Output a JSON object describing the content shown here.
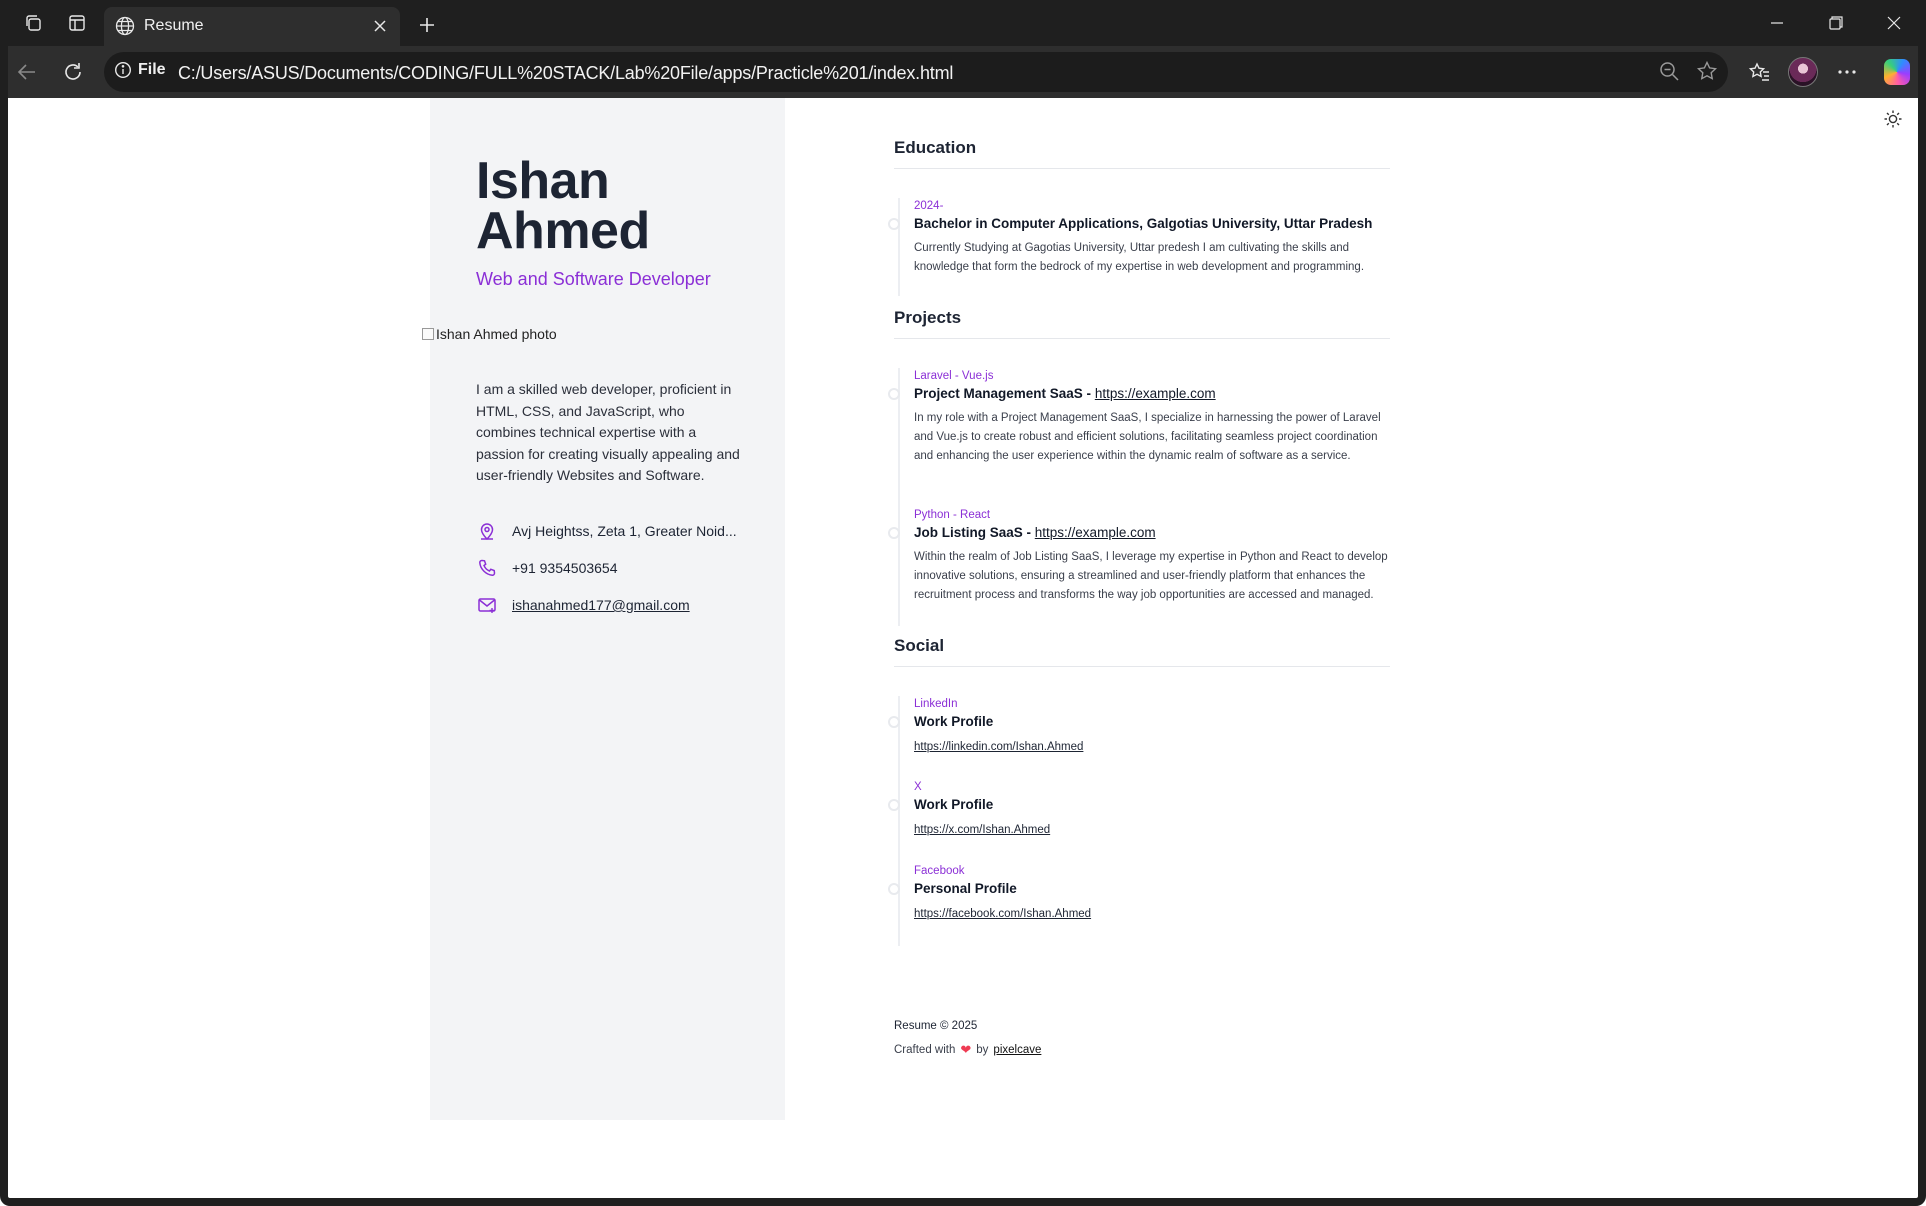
{
  "browser": {
    "tab_title": "Resume",
    "url_label": "File",
    "url": "C:/Users/ASUS/Documents/CODING/FULL%20STACK/Lab%20File/apps/Practicle%201/index.html"
  },
  "profile": {
    "first_name": "Ishan",
    "last_name": "Ahmed",
    "role": "Web and Software Developer",
    "photo_alt": "Ishan Ahmed photo",
    "bio": "I am a skilled web developer, proficient in HTML, CSS, and JavaScript, who combines technical expertise with a passion for creating visually appealing and user-friendly Websites and Software.",
    "address": "Avj Heightss, Zeta 1, Greater Noid...",
    "phone": "+91 9354503654",
    "email": "ishanahmed177@gmail.com"
  },
  "education": {
    "title": "Education",
    "items": [
      {
        "meta": "2024-",
        "heading": "Bachelor in Computer Applications, Galgotias University, Uttar Pradesh",
        "description": "Currently Studying at Gagotias University, Uttar predesh I am cultivating the skills and knowledge that form the bedrock of my expertise in web development and programming."
      }
    ]
  },
  "projects": {
    "title": "Projects",
    "items": [
      {
        "meta": "Laravel - Vue.js",
        "heading": "Project Management SaaS - ",
        "link": "https://example.com",
        "description": "In my role with a Project Management SaaS, I specialize in harnessing the power of Laravel and Vue.js to create robust and efficient solutions, facilitating seamless project coordination and enhancing the user experience within the dynamic realm of software as a service."
      },
      {
        "meta": "Python - React",
        "heading": "Job Listing SaaS - ",
        "link": "https://example.com",
        "description": "Within the realm of Job Listing SaaS, I leverage my expertise in Python and React to develop innovative solutions, ensuring a streamlined and user-friendly platform that enhances the recruitment process and transforms the way job opportunities are accessed and managed."
      }
    ]
  },
  "social": {
    "title": "Social",
    "items": [
      {
        "meta": "LinkedIn",
        "heading": "Work Profile",
        "link": "https://linkedin.com/Ishan.Ahmed"
      },
      {
        "meta": "X",
        "heading": "Work Profile",
        "link": "https://x.com/Ishan.Ahmed"
      },
      {
        "meta": "Facebook",
        "heading": "Personal Profile",
        "link": "https://facebook.com/Ishan.Ahmed"
      }
    ]
  },
  "footer": {
    "copyright": "Resume © 2025",
    "crafted": "Crafted with",
    "by": "by",
    "author": "pixelcave"
  },
  "colors": {
    "accent": "#8b2fd6",
    "sidebar_bg": "#f3f4f6",
    "heart": "#ef3b53"
  }
}
